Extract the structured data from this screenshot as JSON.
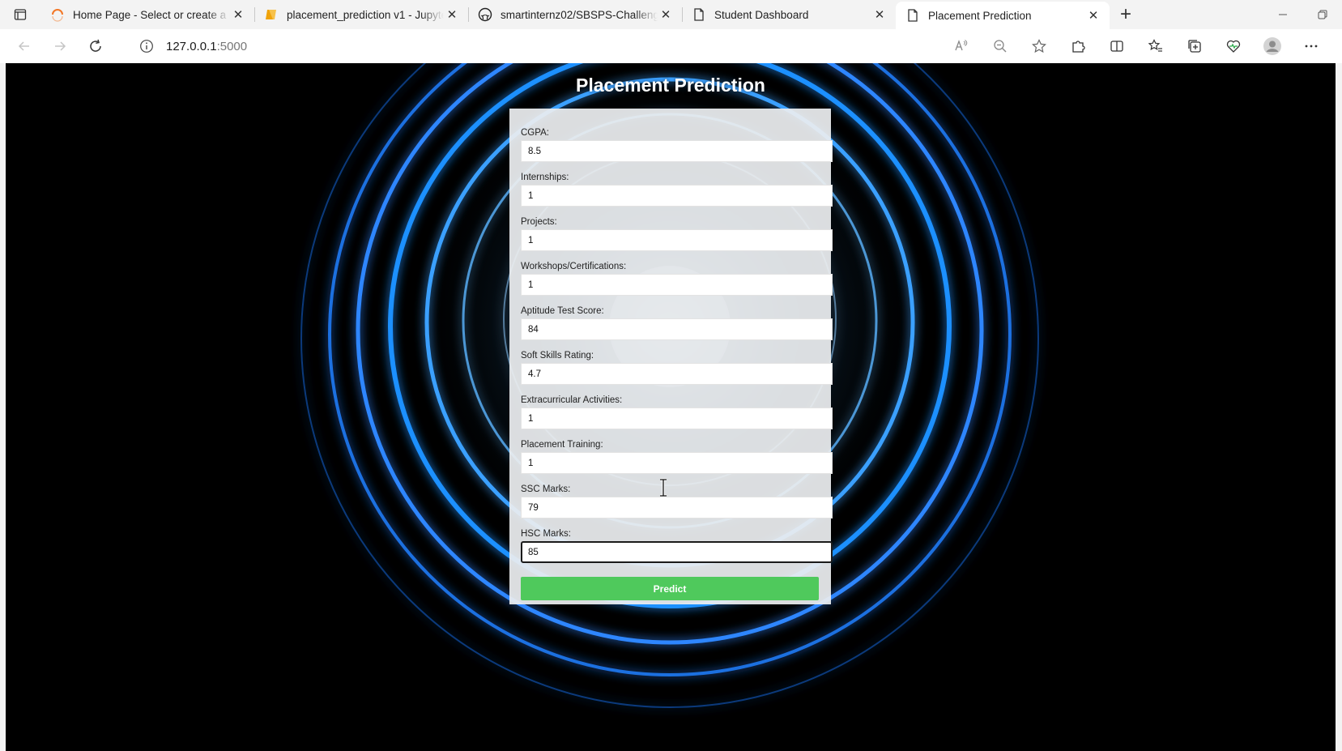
{
  "browser": {
    "tabs": [
      {
        "title": "Home Page - Select or create a n",
        "icon": "jupyter-spinner-icon",
        "active": false
      },
      {
        "title": "placement_prediction v1 - Jupyte",
        "icon": "notebook-icon",
        "active": false
      },
      {
        "title": "smartinternz02/SBSPS-Challenge",
        "icon": "github-icon",
        "active": false
      },
      {
        "title": "Student Dashboard",
        "icon": "page-icon",
        "active": false
      },
      {
        "title": "Placement Prediction",
        "icon": "page-icon",
        "active": true
      }
    ],
    "address": {
      "host": "127.0.0.1",
      "port": ":5000"
    }
  },
  "page": {
    "title": "Placement Prediction",
    "fields": [
      {
        "label": "CGPA:",
        "value": "8.5"
      },
      {
        "label": "Internships:",
        "value": "1"
      },
      {
        "label": "Projects:",
        "value": "1"
      },
      {
        "label": "Workshops/Certifications:",
        "value": "1"
      },
      {
        "label": "Aptitude Test Score:",
        "value": "84"
      },
      {
        "label": "Soft Skills Rating:",
        "value": "4.7"
      },
      {
        "label": "Extracurricular Activities:",
        "value": "1"
      },
      {
        "label": "Placement Training:",
        "value": "1"
      },
      {
        "label": "SSC Marks:",
        "value": "79"
      },
      {
        "label": "HSC Marks:",
        "value": "85"
      }
    ],
    "submit_label": "Predict"
  },
  "colors": {
    "ring": "#1e90ff",
    "predict_button": "#4fc95c",
    "background": "#000000"
  }
}
